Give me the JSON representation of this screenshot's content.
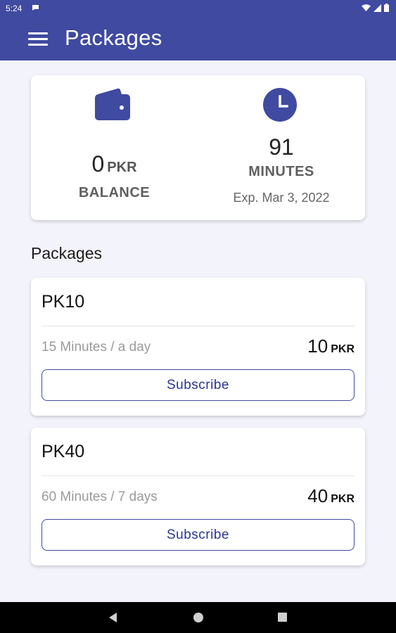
{
  "status_bar": {
    "time": "5:24",
    "icons": [
      "message-notification-icon",
      "wifi-icon",
      "signal-icon",
      "battery-icon"
    ]
  },
  "app_bar": {
    "title": "Packages",
    "menu_icon": "hamburger-menu-icon"
  },
  "summary": {
    "balance_value": "0",
    "balance_unit": "PKR",
    "balance_label": "BALANCE",
    "minutes_value": "91",
    "minutes_label": "MINUTES",
    "expiry": "Exp. Mar 3, 2022",
    "wallet_icon": "wallet-icon",
    "clock_icon": "clock-icon"
  },
  "section_heading": "Packages",
  "packages": [
    {
      "name": "PK10",
      "description": "15 Minutes / a day",
      "price": "10",
      "currency": "PKR",
      "button_label": "Subscribe"
    },
    {
      "name": "PK40",
      "description": "60 Minutes / 7 days",
      "price": "40",
      "currency": "PKR",
      "button_label": "Subscribe"
    }
  ],
  "colors": {
    "primary": "#3f4aa0",
    "background": "#f3f3fb",
    "card": "#ffffff",
    "muted_text": "#9a9a9a"
  },
  "nav_bar": {
    "icons": [
      "back-icon",
      "home-icon",
      "recents-icon"
    ]
  }
}
